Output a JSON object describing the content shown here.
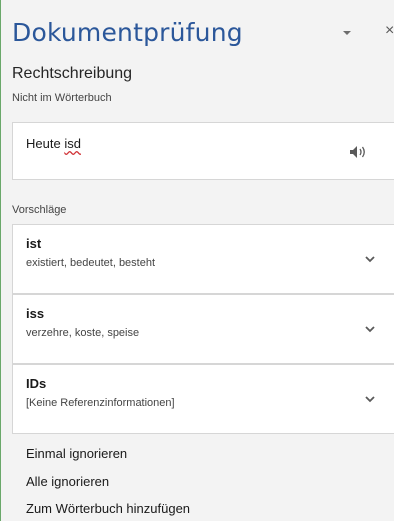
{
  "pane": {
    "title": "Dokumentprüfung",
    "close_glyph": "×",
    "dropdown_icon": "chevron-down-icon"
  },
  "spelling": {
    "heading": "Rechtschreibung",
    "subheading": "Nicht im Wörterbuch",
    "context_prefix": "Heute ",
    "context_error": "isd",
    "speaker_icon": "speaker-icon"
  },
  "suggestions": {
    "label": "Vorschläge",
    "items": [
      {
        "word": "ist",
        "synonyms": "existiert, bedeutet, besteht"
      },
      {
        "word": "iss",
        "synonyms": "verzehre, koste, speise"
      },
      {
        "word": "IDs",
        "synonyms": "[Keine Referenzinformationen]"
      }
    ]
  },
  "actions": {
    "ignore_once": "Einmal ignorieren",
    "ignore_all": "Alle ignorieren",
    "add_to_dictionary": "Zum Wörterbuch hinzufügen"
  },
  "colors": {
    "title_blue": "#2b579a",
    "error_underline": "#d13438",
    "pane_background": "#f3f3f3",
    "card_background": "#ffffff"
  }
}
